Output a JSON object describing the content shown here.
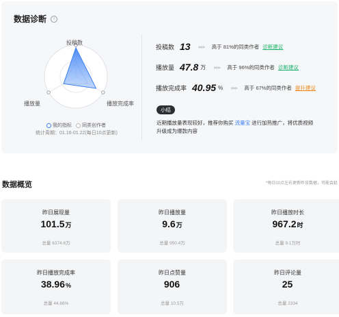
{
  "diagnosis": {
    "title": "数据诊断",
    "radar": {
      "axes": [
        "投稿数",
        "播放完成率",
        "播放量"
      ],
      "legend": {
        "mine": "我的指标",
        "peer": "同类创作者"
      },
      "period": "统计周期：01.16-01.22(每日10点更新)",
      "mine_values": [
        0.92,
        0.74,
        0.45
      ],
      "peer_values": [
        0.45,
        0.45,
        0.45
      ],
      "colors": {
        "mine_fill": "#4f8ff7",
        "mine_stroke": "#3b7ff5",
        "peer_stroke": "#c9ccd2"
      }
    },
    "metrics": [
      {
        "label": "投稿数",
        "value": "13",
        "unit": "",
        "arrows": "▸▸▸",
        "compare": "高于 81%的同类作者",
        "link": "诊断建议",
        "link_color": "green"
      },
      {
        "label": "播放量",
        "value": "47.8",
        "unit": "万",
        "arrows": "▸▸▸",
        "compare": "高于 96%的同类作者",
        "link": "诊断建议",
        "link_color": "green"
      },
      {
        "label": "播放完成率",
        "value": "40.95",
        "unit": "%",
        "arrows": "▸▸▸",
        "compare": "高于 67%的同类作者",
        "link": "提升建议",
        "link_color": "orange"
      }
    ],
    "tip": {
      "badge": "小结",
      "text_before": "近期播放量表现较好，推荐你购买 ",
      "highlight": "流量宝",
      "text_after": " 进行加热推广，将优质视频升级成为爆款内容"
    }
  },
  "overview": {
    "title": "数据概览",
    "note": "*每日10点左右更新昨日数据，可能会延",
    "cards": [
      {
        "label": "昨日展现量",
        "value": "101.5",
        "unit": "万",
        "total": "总量 6374.6万"
      },
      {
        "label": "昨日播放量",
        "value": "9.6",
        "unit": "万",
        "total": "总量 950.4万"
      },
      {
        "label": "昨日播放时长",
        "value": "967.2",
        "unit": "时",
        "total": "总量 9.1万时"
      },
      {
        "label": "昨日播放完成率",
        "value": "38.96",
        "unit": "%",
        "total": "总量 44.66%"
      },
      {
        "label": "昨日点赞量",
        "value": "906",
        "unit": "",
        "total": "总量 10.5万"
      },
      {
        "label": "昨日评论量",
        "value": "25",
        "unit": "",
        "total": "总量 2334"
      }
    ]
  }
}
